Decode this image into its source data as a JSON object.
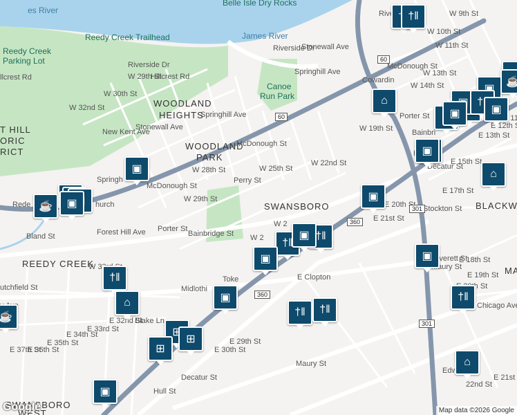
{
  "colors": {
    "water": "#a9d3ec",
    "park": "#c6e6c3",
    "highway": "#8596ac",
    "major": "#ffffff",
    "marker": "#0e4a6b"
  },
  "neighborhoods": [
    {
      "id": "woodland-heights-1",
      "text": "WOODLAND"
    },
    {
      "id": "woodland-heights-2",
      "text": "HEIGHTS"
    },
    {
      "id": "woodland-park-1",
      "text": "WOODLAND"
    },
    {
      "id": "woodland-park-2",
      "text": "PARK"
    },
    {
      "id": "swansboro",
      "text": "SWANSBORO"
    },
    {
      "id": "reedy-creek",
      "text": "REEDY CREEK"
    },
    {
      "id": "blackwell",
      "text": "BLACKWE"
    },
    {
      "id": "forest-hill-1",
      "text": "T HILL"
    },
    {
      "id": "forest-hill-2",
      "text": "ORIC"
    },
    {
      "id": "forest-hill-3",
      "text": "RICT"
    },
    {
      "id": "swansboro-west-1",
      "text": "SWANSBORO"
    },
    {
      "id": "swansboro-west-2",
      "text": "WEST"
    },
    {
      "id": "ma",
      "text": "MA"
    }
  ],
  "pois": [
    {
      "id": "belle-isle",
      "text": "Belle Isle Dry Rocks"
    },
    {
      "id": "reedy-creek-trailhead",
      "text": "Reedy Creek Trailhead"
    },
    {
      "id": "reedy-creek-parking-1",
      "text": "Reedy Creek"
    },
    {
      "id": "reedy-creek-parking-2",
      "text": "Parking Lot"
    },
    {
      "id": "canoe-run-1",
      "text": "Canoe"
    },
    {
      "id": "canoe-run-2",
      "text": "Run Park"
    },
    {
      "id": "church",
      "text": "Rede"
    },
    {
      "id": "church2",
      "text": "hurch"
    }
  ],
  "water_labels": [
    {
      "id": "james-river",
      "text": "James River"
    },
    {
      "id": "river-nw",
      "text": "es River"
    }
  ],
  "streets": [
    "W 32nd St",
    "W 30th St",
    "W 29th St",
    "Hillcrest Rd",
    "llcrest Rd",
    "Riverside Dr",
    "Riverside Dr",
    "Stonewall Ave",
    "Springhill Ave",
    "New Kent Ave",
    "Stonewall Ave",
    "Springhill Ave",
    "McDonough St",
    "Perry St",
    "W 25th St",
    "W 22nd St",
    "W 19th St",
    "W 28th St",
    "W 29th St",
    "McDonough St",
    "Porter St",
    "Bainbridge St",
    "Forest Hill Ave",
    "Midlothi",
    "Toke",
    "Hull St",
    "Decatur St",
    "E 29th St",
    "E 30th St",
    "E 37th St",
    "E 36th St",
    "E 35th St",
    "E 34th St",
    "E 33rd St",
    "E 32nd St",
    "Blake Ln",
    "W 33rd St",
    "Bland St",
    "utchfield St",
    "y Ave",
    "E Clopton",
    "Maury St",
    "E 20th St",
    "E 21st St",
    "Stockton St",
    "E 17th St",
    "E 15th St",
    "Decatur St",
    "E 13th St",
    "E 12th St",
    "E 11th",
    "W 9th St",
    "W 10th St",
    "W 11th St",
    "W 13th St",
    "W 14th St",
    "Porter St",
    "McDonough St",
    "Riverside",
    "Cowardin",
    "E 18th St",
    "E 19th St",
    "E 20th St",
    "Chicago Ave",
    "Edwa",
    "22nd St",
    "E 21st",
    "Maury St",
    "Everett St",
    "Bainbri",
    "Hu",
    "W 2",
    "Springh",
    "W 2"
  ],
  "shields": [
    "60",
    "60",
    "360",
    "360",
    "301",
    "301"
  ],
  "markers": [
    "restaurant",
    "restaurant",
    "grocery",
    "coffee",
    "grocery",
    "grocery",
    "grocery",
    "grocery",
    "school",
    "restaurant",
    "restaurant",
    "grocery",
    "grocery",
    "grocery",
    "grocery",
    "restaurant",
    "school",
    "grocery",
    "grocery",
    "restaurant",
    "restaurant",
    "restaurant",
    "school",
    "grocery",
    "shopping-cart",
    "shopping-cart",
    "shopping-cart",
    "grocery",
    "restaurant",
    "school",
    "grocery",
    "coffee",
    "grocery",
    "grocery",
    "restaurant",
    "grocery",
    "grocery",
    "coffee",
    "grocery"
  ],
  "footer": {
    "logo": "Google",
    "attribution": "Map data ©2026 Google"
  }
}
